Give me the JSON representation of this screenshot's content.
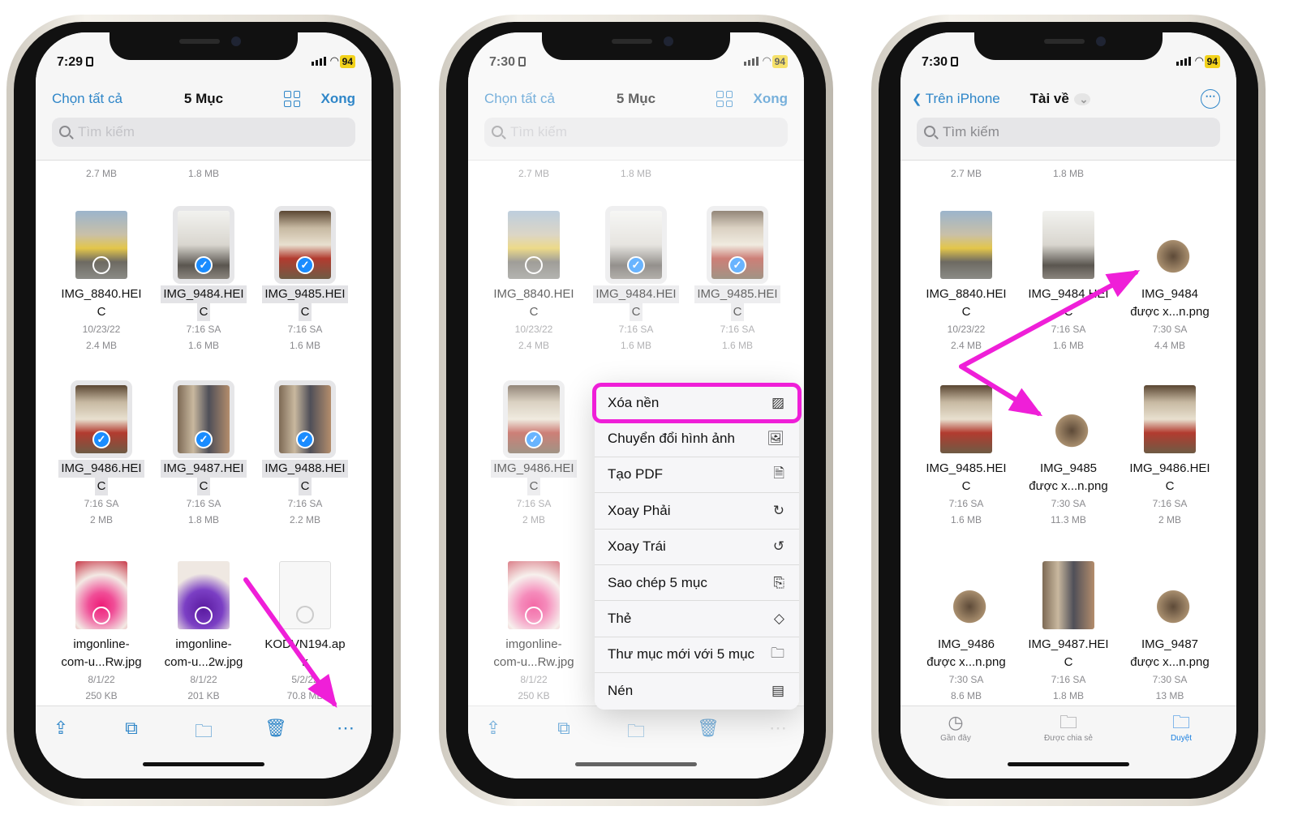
{
  "accent_color": "#2f86c8",
  "annotation_color": "#ef1fd8",
  "phones": [
    {
      "time": "7:29",
      "battery": "94",
      "nav": {
        "left": "Chọn tất cả",
        "title": "5 Mục",
        "right": "Xong"
      },
      "search_placeholder": "Tìm kiếm",
      "top_sizes": [
        "2.7 MB",
        "1.8 MB"
      ],
      "files": [
        {
          "name1": "IMG_8840.HEI",
          "name2": "C",
          "date": "10/23/22",
          "size": "2.4 MB",
          "selected": false,
          "thumb": "street"
        },
        {
          "name1": "IMG_9484.HEI",
          "name2": "C",
          "date": "7:16 SA",
          "size": "1.6 MB",
          "selected": true,
          "thumb": "room"
        },
        {
          "name1": "IMG_9485.HEI",
          "name2": "C",
          "date": "7:16 SA",
          "size": "1.6 MB",
          "selected": true,
          "thumb": "shop"
        },
        {
          "name1": "IMG_9486.HEI",
          "name2": "C",
          "date": "7:16 SA",
          "size": "2 MB",
          "selected": true,
          "thumb": "shop"
        },
        {
          "name1": "IMG_9487.HEI",
          "name2": "C",
          "date": "7:16 SA",
          "size": "1.8 MB",
          "selected": true,
          "thumb": "shelf"
        },
        {
          "name1": "IMG_9488.HEI",
          "name2": "C",
          "date": "7:16 SA",
          "size": "2.2 MB",
          "selected": true,
          "thumb": "shelf"
        },
        {
          "name1": "imgonline-",
          "name2": "com-u...Rw.jpg",
          "date": "8/1/22",
          "size": "250 KB",
          "selected": false,
          "thumb": "pink"
        },
        {
          "name1": "imgonline-",
          "name2": "com-u...2w.jpg",
          "date": "8/1/22",
          "size": "201 KB",
          "selected": false,
          "thumb": "purple"
        },
        {
          "name1": "KODVN194.ap",
          "name2": "k",
          "date": "5/2/22",
          "size": "70.8 MB",
          "selected": false,
          "thumb": "doc"
        }
      ],
      "toolbar": [
        {
          "icon": "share-icon",
          "glyph": "⇪"
        },
        {
          "icon": "duplicate-icon",
          "glyph": "⧉"
        },
        {
          "icon": "folder-icon",
          "glyph": "🗀"
        },
        {
          "icon": "trash-icon",
          "glyph": "🗑"
        },
        {
          "icon": "more-icon",
          "glyph": "⋯"
        }
      ]
    },
    {
      "time": "7:30",
      "battery": "94",
      "nav": {
        "left": "Chọn tất cả",
        "title": "5 Mục",
        "right": "Xong"
      },
      "search_placeholder": "Tìm kiếm",
      "top_sizes": [
        "2.7 MB",
        "1.8 MB"
      ],
      "files": [
        {
          "name1": "IMG_8840.HEI",
          "name2": "C",
          "date": "10/23/22",
          "size": "2.4 MB",
          "selected": false,
          "thumb": "street"
        },
        {
          "name1": "IMG_9484.HEI",
          "name2": "C",
          "date": "7:16 SA",
          "size": "1.6 MB",
          "selected": true,
          "thumb": "room"
        },
        {
          "name1": "IMG_9485.HEI",
          "name2": "C",
          "date": "7:16 SA",
          "size": "1.6 MB",
          "selected": true,
          "thumb": "shop"
        },
        {
          "name1": "IMG_9486.HEI",
          "name2": "C",
          "date": "7:16 SA",
          "size": "2 MB",
          "selected": true,
          "thumb": "shop"
        },
        null,
        null,
        {
          "name1": "imgonline-",
          "name2": "com-u...Rw.jpg",
          "date": "8/1/22",
          "size": "250 KB",
          "selected": false,
          "thumb": "pink"
        }
      ],
      "toolbar": [
        {
          "icon": "share-icon",
          "glyph": "⇪"
        },
        {
          "icon": "duplicate-icon",
          "glyph": "⧉"
        },
        {
          "icon": "folder-icon",
          "glyph": "🗀"
        },
        {
          "icon": "trash-icon",
          "glyph": "🗑"
        },
        {
          "icon": "more-icon",
          "glyph": "⋯"
        }
      ],
      "menu": [
        {
          "label": "Xóa nền",
          "icon": "remove-background-icon",
          "glyph": "▨",
          "highlighted": true
        },
        {
          "label": "Chuyển đổi hình ảnh",
          "icon": "convert-image-icon",
          "glyph": "🖼"
        },
        {
          "label": "Tạo PDF",
          "icon": "pdf-icon",
          "glyph": "🗎"
        },
        {
          "label": "Xoay Phải",
          "icon": "rotate-right-icon",
          "glyph": "↻"
        },
        {
          "label": "Xoay Trái",
          "icon": "rotate-left-icon",
          "glyph": "↺"
        },
        {
          "label": "Sao chép 5 mục",
          "icon": "copy-icon",
          "glyph": "⎘"
        },
        {
          "label": "Thẻ",
          "icon": "tag-icon",
          "glyph": "◇"
        },
        {
          "label": "Thư mục mới với 5 mục",
          "icon": "new-folder-icon",
          "glyph": "🗀"
        },
        {
          "label": "Nén",
          "icon": "archive-icon",
          "glyph": "▤"
        }
      ]
    },
    {
      "time": "7:30",
      "battery": "94",
      "nav": {
        "back": "Trên iPhone",
        "title": "Tài về"
      },
      "search_placeholder": "Tìm kiếm",
      "top_sizes": [
        "2.7 MB",
        "1.8 MB"
      ],
      "files": [
        {
          "name1": "IMG_8840.HEI",
          "name2": "C",
          "date": "10/23/22",
          "size": "2.4 MB",
          "thumb": "street"
        },
        {
          "name1": "IMG_9484.HEI",
          "name2": "C",
          "date": "7:16 SA",
          "size": "1.6 MB",
          "thumb": "room"
        },
        {
          "name1": "IMG_9484",
          "name2": "được x...n.png",
          "date": "7:30 SA",
          "size": "4.4 MB",
          "thumb": "cutout"
        },
        {
          "name1": "IMG_9485.HEI",
          "name2": "C",
          "date": "7:16 SA",
          "size": "1.6 MB",
          "thumb": "shop"
        },
        {
          "name1": "IMG_9485",
          "name2": "được x...n.png",
          "date": "7:30 SA",
          "size": "11.3 MB",
          "thumb": "cutout"
        },
        {
          "name1": "IMG_9486.HEI",
          "name2": "C",
          "date": "7:16 SA",
          "size": "2 MB",
          "thumb": "shop"
        },
        {
          "name1": "IMG_9486",
          "name2": "được x...n.png",
          "date": "7:30 SA",
          "size": "8.6 MB",
          "thumb": "cutout"
        },
        {
          "name1": "IMG_9487.HEI",
          "name2": "C",
          "date": "7:16 SA",
          "size": "1.8 MB",
          "thumb": "shelf"
        },
        {
          "name1": "IMG_9487",
          "name2": "được x...n.png",
          "date": "7:30 SA",
          "size": "13 MB",
          "thumb": "cutout"
        }
      ],
      "tabs": [
        {
          "label": "Gần đây",
          "icon": "clock-icon",
          "glyph": "◷",
          "active": false
        },
        {
          "label": "Được chia sẻ",
          "icon": "shared-folder-icon",
          "glyph": "🗀",
          "active": false
        },
        {
          "label": "Duyệt",
          "icon": "browse-folder-icon",
          "glyph": "🗀",
          "active": true
        }
      ]
    }
  ]
}
